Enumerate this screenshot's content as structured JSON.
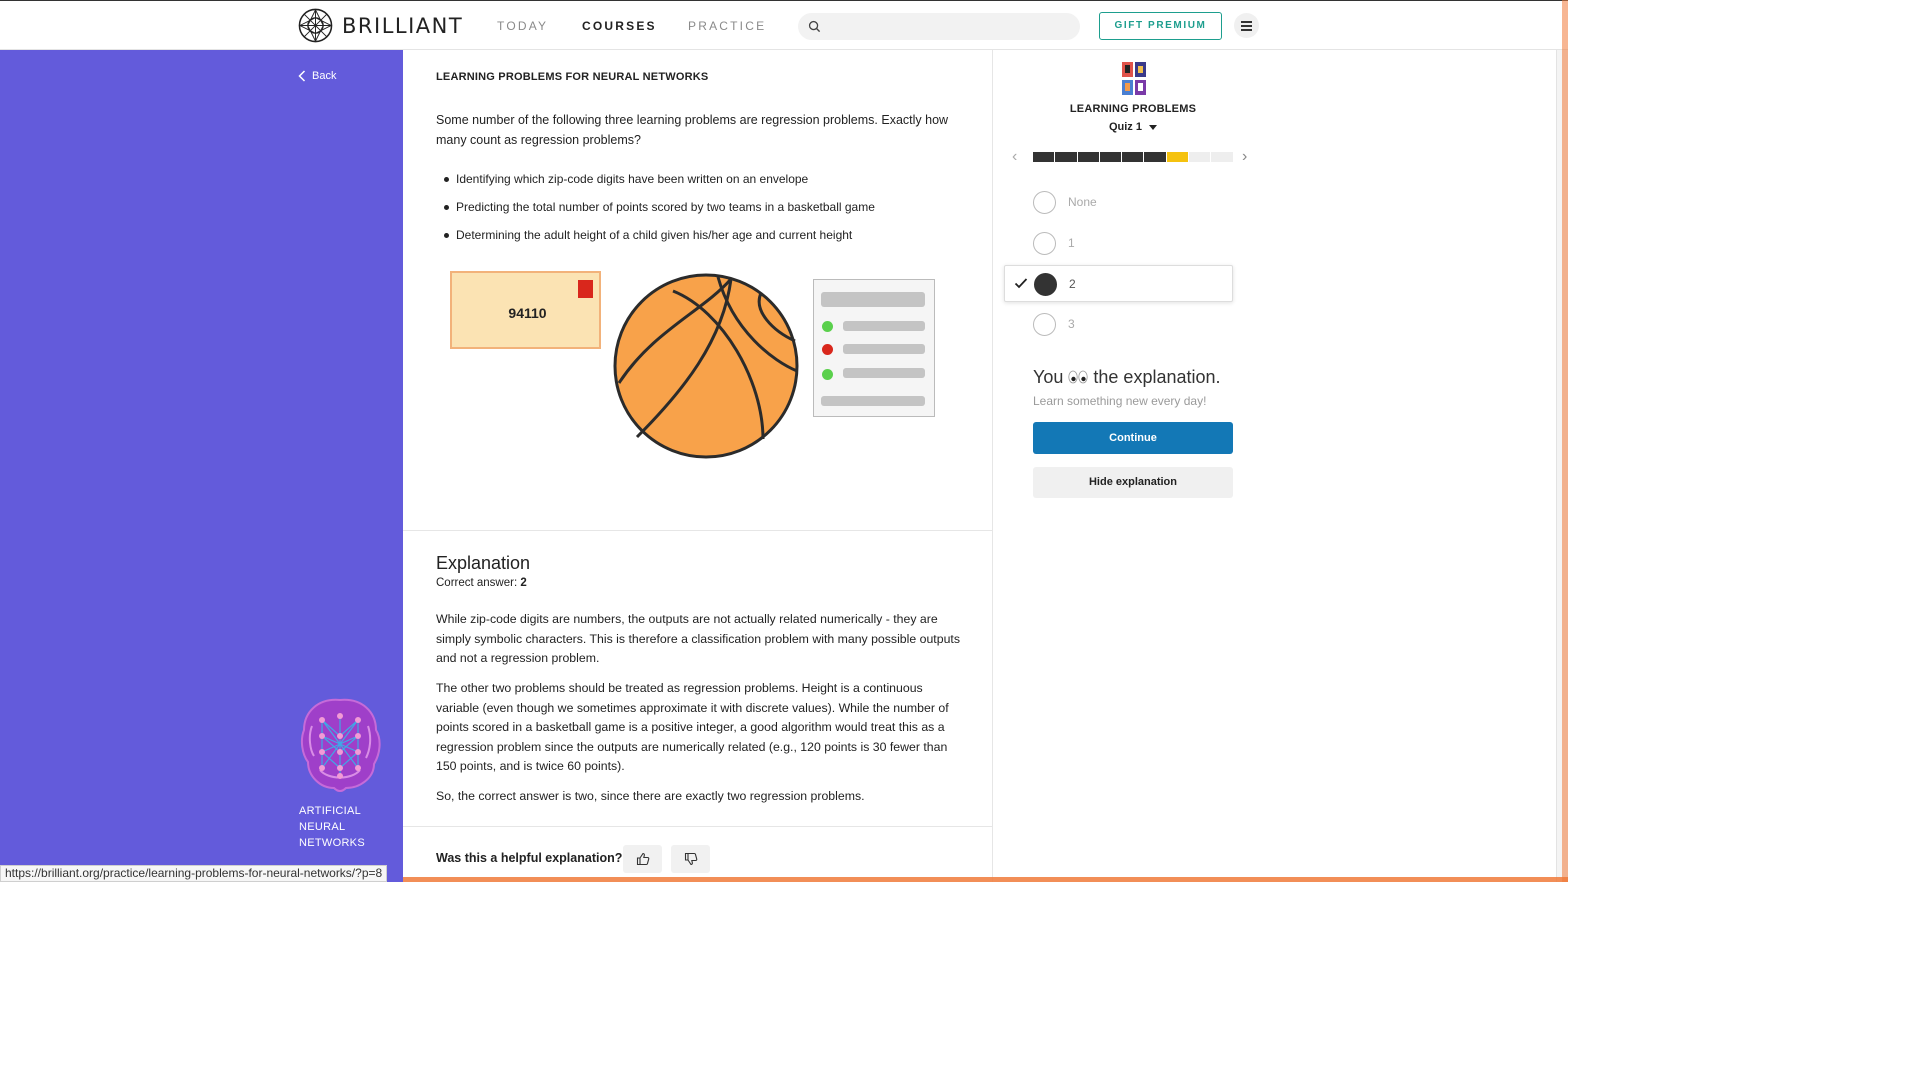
{
  "brand": {
    "name": "BRILLIANT"
  },
  "nav": {
    "today": "TODAY",
    "courses": "COURSES",
    "practice": "PRACTICE",
    "gift": "GIFT PREMIUM"
  },
  "sidebar": {
    "back": "Back",
    "course_title": "ARTIFICIAL NEURAL NETWORKS"
  },
  "problem": {
    "title": "LEARNING PROBLEMS FOR NEURAL NETWORKS",
    "question": "Some number of the following three learning problems are regression problems. Exactly how many count as regression problems?",
    "items": [
      "Identifying which zip-code digits have been written on an envelope",
      "Predicting the total number of points scored by two teams in a basketball game",
      "Determining the adult height of a child given his/her age and current height"
    ],
    "zip": "94110"
  },
  "explanation": {
    "heading": "Explanation",
    "correct_label": "Correct answer: ",
    "correct_value": "2",
    "p1": "While zip-code digits are numbers, the outputs are not actually related numerically - they are simply symbolic characters. This is therefore a classification problem with many possible outputs and not a regression problem.",
    "p2": "The other two problems should be treated as regression problems. Height is a continuous variable (even though we sometimes approximate it with discrete values). While the number of points scored in a basketball game is a positive integer, a good algorithm would treat this as a regression problem since the outputs are numerically related (e.g., 120 points is 30 fewer than 150 points, and is twice 60 points).",
    "p3": "So, the correct answer is two, since there are exactly two regression problems.",
    "helpful": "Was this a helpful explanation?"
  },
  "quiz": {
    "title": "LEARNING PROBLEMS",
    "quiz_label": "Quiz 1",
    "progress": {
      "completed": 6,
      "current": 7,
      "total": 9
    },
    "options": [
      "None",
      "1",
      "2",
      "3"
    ],
    "selected": "2",
    "you_line_pre": "You",
    "you_line_post": "the explanation.",
    "learn_line": "Learn something new every day!",
    "continue": "Continue",
    "hide": "Hide explanation"
  },
  "status_url": "https://brilliant.org/practice/learning-problems-for-neural-networks/?p=8",
  "colors": {
    "sidebar": "#635bdb",
    "accent": "#1d9e8e",
    "continue": "#1378b6",
    "progress_done": "#333333",
    "progress_current": "#f5c20f"
  }
}
